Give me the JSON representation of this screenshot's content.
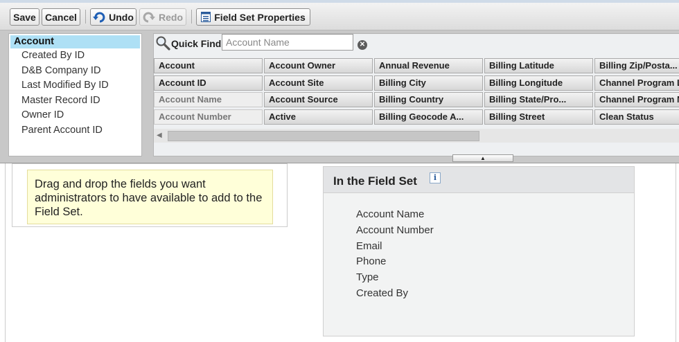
{
  "toolbar": {
    "save": "Save",
    "cancel": "Cancel",
    "undo": "Undo",
    "redo": "Redo",
    "field_set_properties": "Field Set Properties"
  },
  "tree": {
    "root": "Account",
    "items": [
      "Created By ID",
      "D&B Company ID",
      "Last Modified By ID",
      "Master Record ID",
      "Owner ID",
      "Parent Account ID"
    ]
  },
  "quick_find": {
    "label": "Quick Find",
    "placeholder": "Account Name"
  },
  "fields_grid": {
    "columns": [
      [
        "Account",
        "Account ID",
        "Account Name",
        "Account Number"
      ],
      [
        "Account Owner",
        "Account Site",
        "Account Source",
        "Active"
      ],
      [
        "Annual Revenue",
        "Billing City",
        "Billing Country",
        "Billing Geocode A..."
      ],
      [
        "Billing Latitude",
        "Billing Longitude",
        "Billing State/Pro...",
        "Billing Street"
      ],
      [
        "Billing Zip/Posta...",
        "Channel Program L",
        "Channel Program N",
        "Clean Status"
      ]
    ],
    "used": [
      "Account Name",
      "Account Number"
    ]
  },
  "tip": {
    "text": "Drag and drop the fields you want administrators to have available to add to the Field Set."
  },
  "field_set": {
    "title": "In the Field Set",
    "info_glyph": "i",
    "items": [
      "Account Name",
      "Account Number",
      "Email",
      "Phone",
      "Type",
      "Created By"
    ]
  },
  "colors": {
    "tree_selected": "#aee0f5",
    "tip_background": "#ffffd9",
    "undo_icon": "#1f5fb5"
  }
}
